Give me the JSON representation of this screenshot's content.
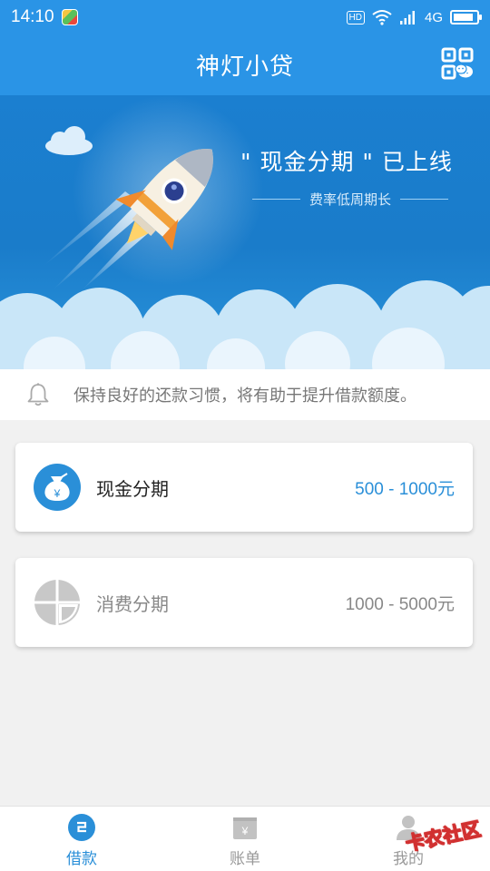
{
  "status_bar": {
    "time": "14:10",
    "hd": "HD",
    "network": "4G",
    "battery_level": 0.84,
    "icons": [
      "app-icon",
      "hd-icon",
      "wifi-icon",
      "signal-icon",
      "battery-icon"
    ]
  },
  "header": {
    "title": "神灯小贷",
    "qr_icon": "qr-scan-icon"
  },
  "banner": {
    "headline": "\" 现金分期 \" 已上线",
    "subtitle": "费率低周期长",
    "colors": {
      "sky": "#1b7fd0",
      "cloud": "#c9e6f8"
    }
  },
  "notice": {
    "icon": "bell-icon",
    "text": "保持良好的还款习惯，将有助于提升借款额度。"
  },
  "products": [
    {
      "title": "现金分期",
      "range": "500 - 1000元",
      "icon": "money-bag-icon",
      "active": true,
      "accent": "#2a8fd8"
    },
    {
      "title": "消费分期",
      "range": "1000 - 5000元",
      "icon": "pie-chart-icon",
      "active": false,
      "accent": "#888888"
    }
  ],
  "bottom_nav": {
    "items": [
      {
        "label": "借款",
        "icon": "loan-icon",
        "active": true
      },
      {
        "label": "账单",
        "icon": "bill-icon",
        "active": false
      },
      {
        "label": "我的",
        "icon": "profile-icon",
        "active": false
      }
    ]
  },
  "watermark": "卡农社区",
  "colors": {
    "primary": "#2a94e6",
    "accent_text": "#2a8fd8",
    "background": "#f1f1f1"
  }
}
